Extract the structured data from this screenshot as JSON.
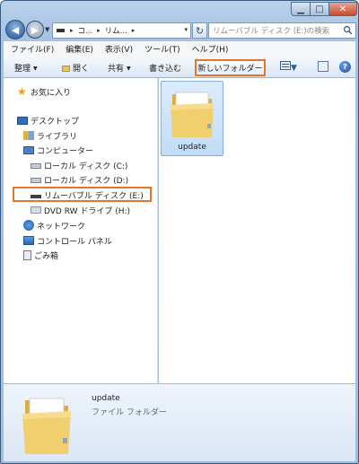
{
  "window": {
    "minimize_glyph": "▁",
    "maximize_glyph": "□",
    "close_glyph": "✕"
  },
  "address": {
    "back_glyph": "◀",
    "forward_glyph": "▶",
    "history_glyph": "▼",
    "crumbs": [
      "コ...",
      "リム...",
      ""
    ],
    "separator": "▸",
    "dropdown_glyph": "▾",
    "refresh_glyph": "↻",
    "search_placeholder": "リムーバブル ディスク (E:)の検索"
  },
  "menu": {
    "items": [
      "ファイル(F)",
      "編集(E)",
      "表示(V)",
      "ツール(T)",
      "ヘルプ(H)"
    ]
  },
  "command_bar": {
    "organize": "整理",
    "open": "開く",
    "share": "共有",
    "burn": "書き込む",
    "new_folder": "新しいフォルダー",
    "caret": "▼",
    "help": "?"
  },
  "nav": {
    "favorites": "お気に入り",
    "desktop": "デスクトップ",
    "libraries": "ライブラリ",
    "computer": "コンピューター",
    "local_c": "ローカル ディスク (C:)",
    "local_d": "ローカル ディスク (D:)",
    "removable_e": "リムーバブル ディスク (E:)",
    "dvd_h": "DVD RW ドライブ (H:)",
    "network": "ネットワーク",
    "control_panel": "コントロール パネル",
    "recycle_bin": "ごみ箱"
  },
  "files": [
    {
      "name": "update"
    }
  ],
  "details": {
    "name": "update",
    "type": "ファイル フォルダー"
  },
  "colors": {
    "highlight_border": "#e8742b",
    "selection": "#c2dcf7",
    "frame": "#a7c3e2"
  }
}
